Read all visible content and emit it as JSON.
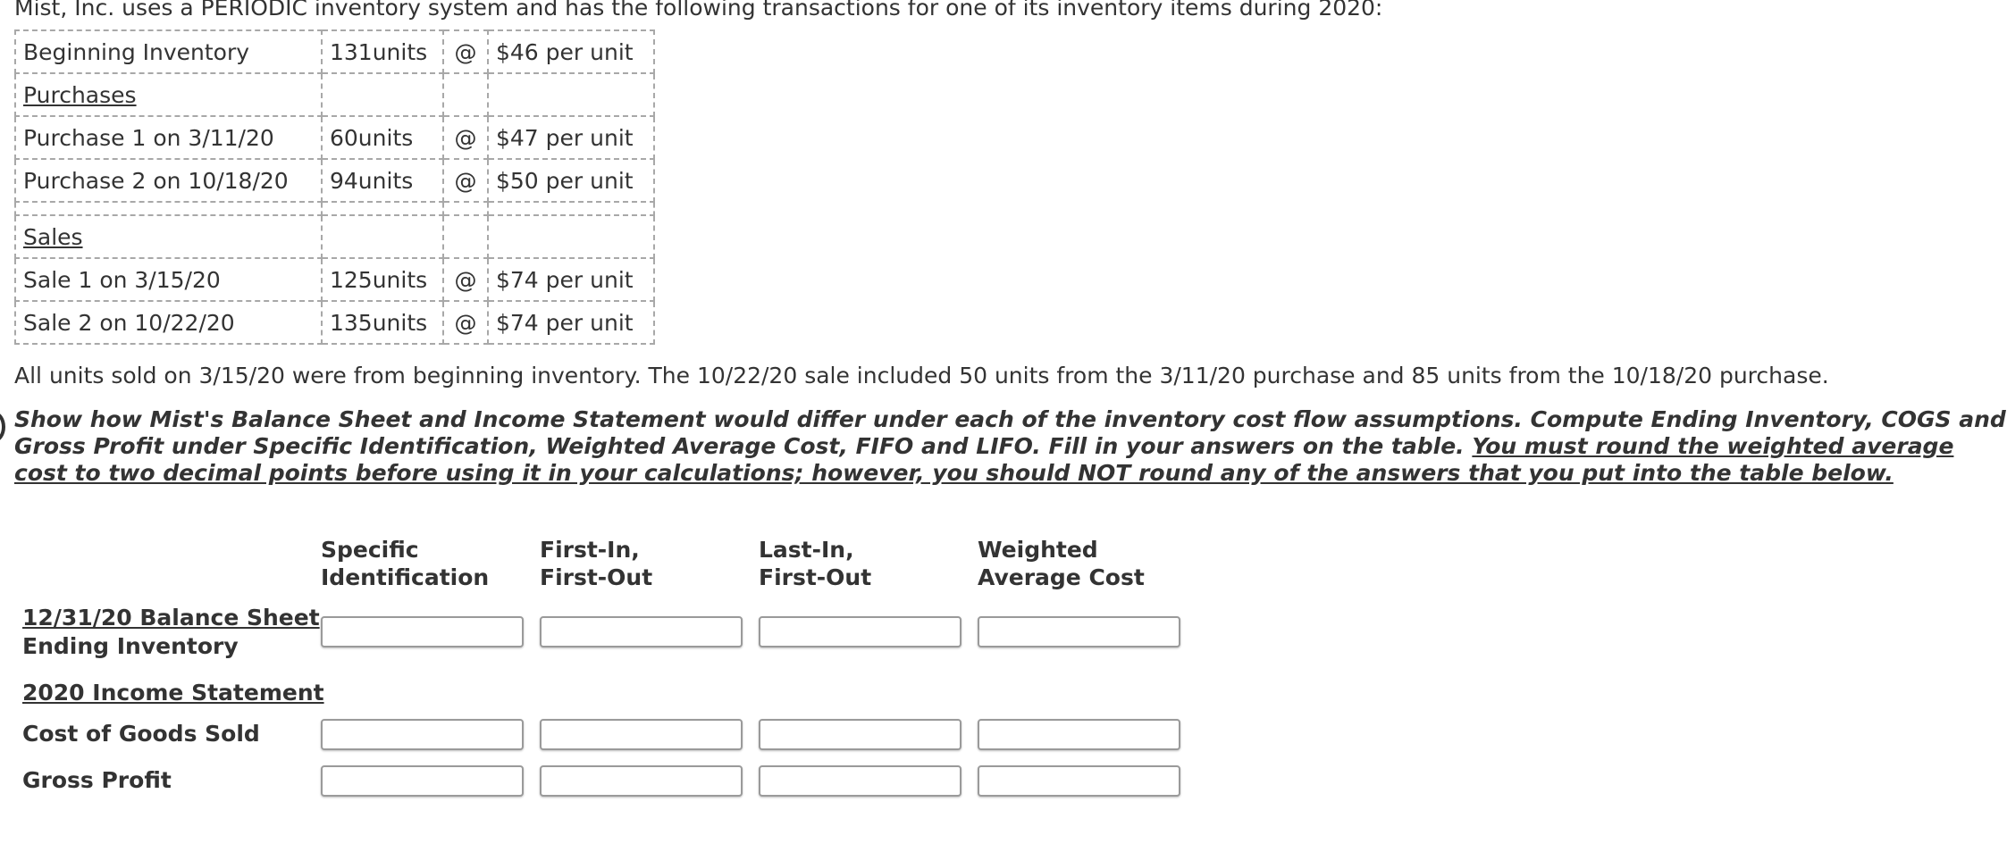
{
  "intro": "Mist, Inc. uses a PERIODIC inventory system and has the following transactions for one of its inventory items during 2020:",
  "transactions": {
    "beginning": {
      "label": "Beginning Inventory",
      "units": "131units",
      "at": "@",
      "price": "$46 per unit"
    },
    "purchases_heading": "Purchases",
    "purchase1": {
      "label": "Purchase 1 on 3/11/20",
      "units": "60units",
      "at": "@",
      "price": "$47 per unit"
    },
    "purchase2": {
      "label": "Purchase 2 on 10/18/20",
      "units": "94units",
      "at": "@",
      "price": "$50 per unit"
    },
    "sales_heading": "Sales",
    "sale1": {
      "label": "Sale 1 on 3/15/20",
      "units": "125units",
      "at": "@",
      "price": "$74 per unit"
    },
    "sale2": {
      "label": "Sale 2 on 10/22/20",
      "units": "135units",
      "at": "@",
      "price": "$74 per unit"
    }
  },
  "note": "All units sold on 3/15/20 were from beginning inventory. The 10/22/20 sale included 50 units from the 3/11/20 purchase and 85 units from the 10/18/20 purchase.",
  "question": {
    "part1": "Show how Mist's Balance Sheet and Income Statement would differ under each of the inventory cost flow assumptions. Compute Ending Inventory, COGS and Gross Profit under Specific Identification, Weighted Average Cost, FIFO and LIFO. Fill in your answers on the table. ",
    "part2_underlined": "You must round the weighted average cost to two decimal points before using it in your calculations; however, you should NOT round any of the answers that you put into the table below."
  },
  "answer_table": {
    "columns": [
      {
        "line1": "Specific",
        "line2": "Identification"
      },
      {
        "line1": "First-In,",
        "line2": "First-Out"
      },
      {
        "line1": "Last-In,",
        "line2": "First-Out"
      },
      {
        "line1": "Weighted",
        "line2": "Average Cost"
      }
    ],
    "balance_sheet_heading": "12/31/20 Balance Sheet",
    "ending_inventory_label": "Ending Inventory",
    "income_statement_heading": "2020 Income Statement",
    "cogs_label": "Cost of Goods Sold",
    "gross_profit_label": "Gross Profit",
    "values": {
      "ending_inventory": [
        "",
        "",
        "",
        ""
      ],
      "cogs": [
        "",
        "",
        "",
        ""
      ],
      "gross_profit": [
        "",
        "",
        "",
        ""
      ]
    }
  }
}
